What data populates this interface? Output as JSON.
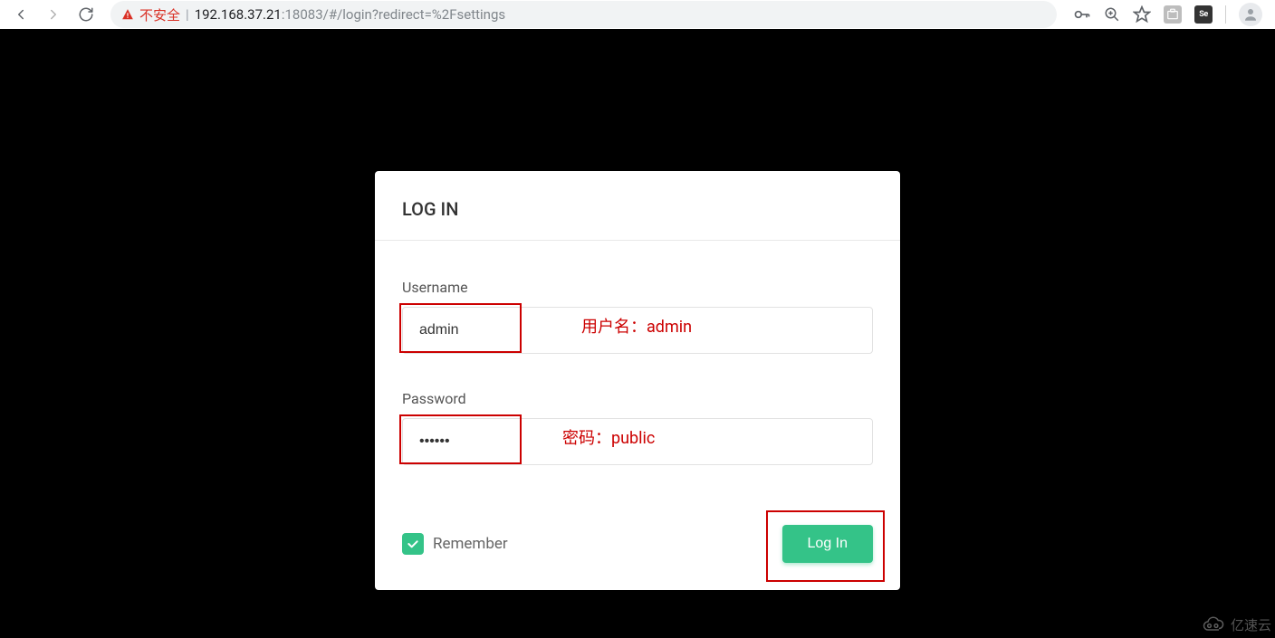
{
  "browser": {
    "security_warning": "不安全",
    "url_host": "192.168.37.21",
    "url_port_path": ":18083/#/login?redirect=%2Fsettings"
  },
  "login": {
    "title": "LOG IN",
    "username_label": "Username",
    "username_value": "admin",
    "password_label": "Password",
    "password_value": "••••••",
    "remember_label": "Remember",
    "submit_label": "Log In"
  },
  "annotations": {
    "username_hint": "用户名：admin",
    "password_hint": "密码：public"
  },
  "watermark": {
    "text": "亿速云"
  }
}
